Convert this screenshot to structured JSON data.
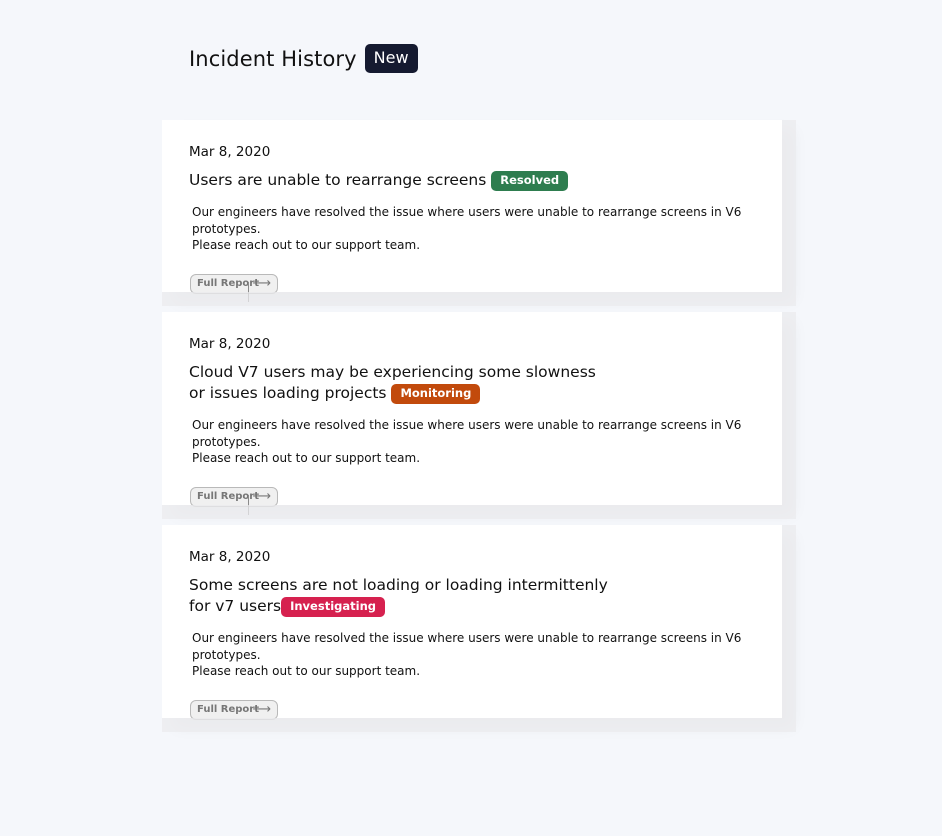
{
  "header": {
    "title": "Incident History",
    "badge": "New"
  },
  "incidents": [
    {
      "date": "Mar 8, 2020",
      "title": "Users are unable to rearrange screens",
      "status": "Resolved",
      "status_color": "#2e7d4f",
      "description_line1": "Our engineers have resolved the issue where users were unable to rearrange screens in V6 prototypes.",
      "description_line2": "Please reach out to our support team.",
      "button_label": "Full Report",
      "button_icon": "arrow-right-icon"
    },
    {
      "date": "Mar 8, 2020",
      "title": "Cloud V7 users may be experiencing some slowness or issues loading projects",
      "status": "Monitoring",
      "status_color": "#c24a0c",
      "description_line1": "Our engineers have resolved the issue where users were unable to rearrange screens in V6 prototypes.",
      "description_line2": "Please reach out to our support team.",
      "button_label": "Full Report",
      "button_icon": "arrow-right-icon"
    },
    {
      "date": "Mar 8, 2020",
      "title": "Some screens are not loading or loading intermittenly for v7 users",
      "status": "Investigating",
      "status_color": "#d6214f",
      "description_line1": "Our engineers have resolved the issue where users were unable to rearrange screens in V6 prototypes.",
      "description_line2": "Please reach out to our support team.",
      "button_label": "Full Report",
      "button_icon": "arrow-right-icon"
    }
  ]
}
